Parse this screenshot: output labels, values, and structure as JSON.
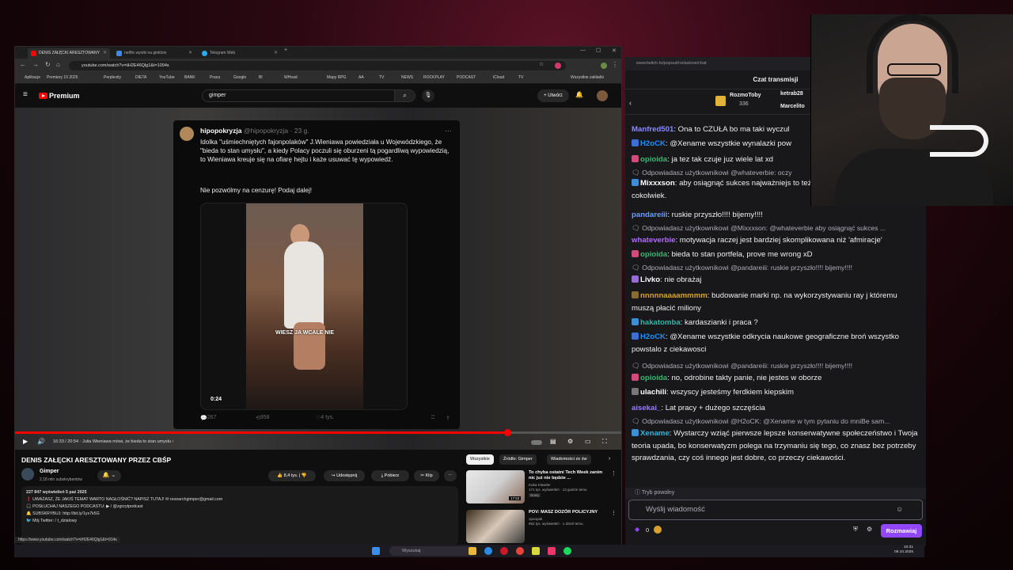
{
  "browser": {
    "tabs": [
      {
        "label": "DENIS ZAŁĘCKI ARESZTOWANY"
      },
      {
        "label": "netflix wyniki na giełdzie"
      },
      {
        "label": "Telegram Web"
      }
    ],
    "url": "youtube.com/watch?v=iiH2E46Qlg1&t=1094s",
    "bookmarks": [
      "Aplikacje",
      "Premiery 10 2025",
      "Perplexity",
      "DIETA",
      "YouTube",
      "BANK",
      "Praca",
      "Google",
      "Bl",
      "WHead",
      "Mapy RPG",
      "AA",
      "TV",
      "NEWS",
      "ROCKPLAY",
      "PODCAST",
      "iCloud",
      "TV",
      "Wszystkie zakładki"
    ]
  },
  "youtube": {
    "logo_text": "Premium",
    "search_value": "gimper",
    "create_label": "Utwórz",
    "tweet": {
      "user": "hipopokryzja",
      "handle": "@hipopokryzja · 23 g.",
      "text": "Idolka \"uśmiechniętych fajonpolaków\" J.Wieniawa powiedziała u Wojewódzkiego, że \"bieda to stan umysłu\", a kiedy Polacy poczuli się oburzeni tą pogardliwą wypowiedzią, to Wieniawa kreuje się na ofiarę hejtu i każe usuwać tę wypowiedź.",
      "text2": "Nie pozwólmy na cenzurę! Podaj dalej!",
      "subtitle": "WIESZ JA WCALE NIE",
      "video_time": "0:24",
      "replies": "267",
      "reposts": "958",
      "likes": "4 tys."
    },
    "player": {
      "progress": 0.81,
      "time": "16:33 / 20:54 · Julia Wieniawa mówi, że bieda to stan umysłu ›"
    },
    "video": {
      "title": "DENIS ZAŁĘCKI ARESZTOWANY PRZEZ CBŚP",
      "channel": "Gimper",
      "subscribers": "2,18 mln subskrybentów",
      "likes": "8,4 tys.",
      "share": "Udostępnij",
      "download": "Pobierz",
      "clip": "Klip"
    },
    "description": [
      "227 847 wyświetleń  5 paź 2025",
      "❗ UWAŻASZ, ŻE JAKIŚ TEMAT WARTO NAGŁOŚNIĆ? NAPISZ TUTAJ! ✉ researchgimper@gmail.com",
      "",
      "🎧 POSŁUCHAJ NASZEGO PODCASTU: ▶ / @zgrzytpodcast",
      "🔔 SUBSKRYBUJ: http://bit.ly/1ys7k5G",
      "🐦 Mój Twitter:  / t_dzialowy"
    ],
    "status_url": "https://www.youtube.com/watch?v=iiH2E46Qlg1&t=914s",
    "chips": [
      "Wszystkie",
      "Źródło: Gimper",
      "Wiadomości ze św"
    ],
    "recommendations": [
      {
        "title": "To chyba ostatni Tech Week zanim nic już nie będzie ...",
        "channel": "Kuba Klawiter",
        "meta": "171 tys. wyświetleń · 13 godzin temu",
        "badge": "Nowy",
        "duration": "17:53"
      },
      {
        "title": "POV: MASZ DOZÓR POLICYJNY",
        "channel": "opoopak",
        "meta": "852 tys. wyświetleń · 1 dzień temu",
        "badge": "",
        "duration": ""
      }
    ]
  },
  "chat": {
    "url": "www.twitch.tv/popout/rockalone/chat",
    "header": "Czat transmisji",
    "gifts": [
      {
        "name": "RozmoToby",
        "count": "336"
      },
      {
        "name": "ketrab28"
      },
      {
        "name": "Marcelito"
      }
    ],
    "messages": [
      {
        "type": "msg",
        "user": "Manfred501",
        "color": "#8a8aff",
        "text": ": Ona to CZUŁA bo ma taki wyczul"
      },
      {
        "type": "msg",
        "user": "H2oCK",
        "color": "#1e90ff",
        "badge": "#3a6fd8",
        "text": ": @Xename wszystkie wynalazki pow"
      },
      {
        "type": "msg",
        "user": "opioida",
        "color": "#3cb371",
        "badge": "#d04a7a",
        "text": ": ja tez tak czuje juz wiele lat xd"
      },
      {
        "type": "reply",
        "text": "🗨 Odpowiadasz użytkownikowi @whateverbie: oczy"
      },
      {
        "type": "msg",
        "user": "Mixxxson",
        "color": "#ffffff",
        "badge": "#3a8fd8",
        "text": ": aby osiągnąć sukces najważniejs to też nazywac afirmowaniem cokolwiek."
      },
      {
        "type": "msg",
        "user": "pandareiii",
        "color": "#6a9cff",
        "text": ": ruskie przyszło!!!! bijemy!!!!"
      },
      {
        "type": "reply",
        "text": "🗨 Odpowiadasz użytkownikowi @Mixxxson: @whateverbie aby osiągnąć sukces ..."
      },
      {
        "type": "msg",
        "user": "whateverbie",
        "color": "#b06aff",
        "text": ": motywacja raczej jest bardziej skomplikowana niż 'afmiracje'"
      },
      {
        "type": "msg",
        "user": "opioida",
        "color": "#3cb371",
        "badge": "#d04a7a",
        "text": ": bieda to stan portfela, prove me wrong xD"
      },
      {
        "type": "reply",
        "text": "🗨 Odpowiadasz użytkownikowi @pandareiii: ruskie przyszło!!!! bijemy!!!!"
      },
      {
        "type": "msg",
        "user": "Livko",
        "color": "#ffffff",
        "badge": "#9a6ad8",
        "text": ": nie obrażaj"
      },
      {
        "type": "msg",
        "user": "nnnnnaaaammmm",
        "color": "#daa520",
        "badge": "#8a6a30",
        "text": ": budowanie marki np. na wykorzystywaniu ray j któremu muszą płacić miliony"
      },
      {
        "type": "msg",
        "user": "hakatomba",
        "color": "#2eb8a8",
        "badge": "#3a8fd8",
        "text": ": kardaszianki i praca ?"
      },
      {
        "type": "msg",
        "user": "H2oCK",
        "color": "#1e90ff",
        "badge": "#3a6fd8",
        "text": ": @Xename wszystkie odkrycia naukowe geograficzne broń wszystko powstalo z ciekawosci"
      },
      {
        "type": "reply",
        "text": "🗨 Odpowiadasz użytkownikowi @pandareiii: ruskie przyszło!!!! bijemy!!!!"
      },
      {
        "type": "msg",
        "user": "opioida",
        "color": "#3cb371",
        "badge": "#d04a7a",
        "text": ": no, odrobine takty panie, nie jestes w oborze"
      },
      {
        "type": "msg",
        "user": "ulachili",
        "color": "#ffffff",
        "badge": "#777777",
        "text": ": wszyscy jesteśmy ferdkiem kiepskim"
      },
      {
        "type": "msg",
        "user": "aisekai_",
        "color": "#9b7bff",
        "text": ": Lat pracy + dużego szczęścia"
      },
      {
        "type": "reply",
        "text": "🗨 Odpowiadasz użytkownikowi @H2oCK: @Xename w tym pytaniu do mniBe sam..."
      },
      {
        "type": "msg",
        "user": "Xename",
        "color": "#2eb8d8",
        "badge": "#3a8fd8",
        "text": ": Wystarczy wziąć pierwsze lepsze konserwatywne społeczeństwo i Twoja teoria upada, bo konserwatyzm polega na trzymaniu się tego, co znasz bez potrzeby sprawdzania, czy coś innego jest dobre, co przeczy ciekawości."
      }
    ],
    "mode_label": "Tryb powolny",
    "input_placeholder": "Wyślij wiadomość",
    "points": "0",
    "send_label": "Rozmawiaj"
  },
  "taskbar": {
    "search_placeholder": "Wyszukaj",
    "time": "10:31",
    "date": "09.10.2025"
  }
}
